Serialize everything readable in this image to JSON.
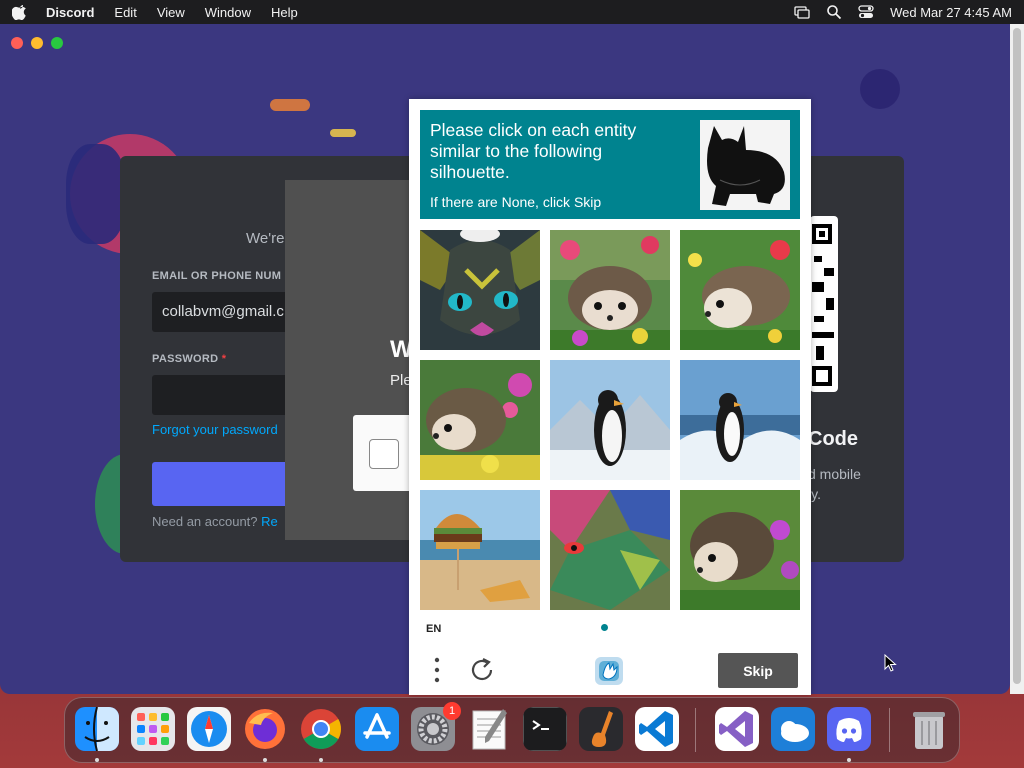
{
  "menubar": {
    "app_name": "Discord",
    "items": [
      "Edit",
      "View",
      "Window",
      "Help"
    ],
    "clock": "Wed Mar 27  4:45 AM",
    "icons": [
      "apple-icon",
      "screen-mirroring-icon",
      "spotlight-search-icon",
      "control-center-icon"
    ]
  },
  "login": {
    "subtitle": "We're",
    "email_label": "EMAIL OR PHONE NUM",
    "email_value": "collabvm@gmail.c",
    "password_label": "PASSWORD",
    "required_mark": "*",
    "forgot_link": "Forgot your password",
    "register_prefix": "Need an account?",
    "register_link": "Re",
    "qr_heading": "Code",
    "qr_sub": "d mobile\nly."
  },
  "overlay": {
    "heading_fragment": "W",
    "sub_fragment": "Ple"
  },
  "captcha": {
    "prompt_title": "Please click on each entity similar to the following silhouette.",
    "prompt_sub": "If there are None, click Skip",
    "tiles": [
      {
        "subject": "cat face"
      },
      {
        "subject": "hedgehog"
      },
      {
        "subject": "hedgehog"
      },
      {
        "subject": "hedgehog"
      },
      {
        "subject": "penguin"
      },
      {
        "subject": "penguin"
      },
      {
        "subject": "burger"
      },
      {
        "subject": "abstract"
      },
      {
        "subject": "hedgehog"
      }
    ],
    "language": "EN",
    "skip_label": "Skip",
    "accent_color": "#00838f"
  },
  "dock": {
    "apps": [
      "Finder",
      "Launchpad",
      "Safari",
      "Firefox",
      "Chrome",
      "App Store",
      "System Settings",
      "TextEdit",
      "Terminal",
      "GarageBand",
      "Visual Studio Code",
      "Visual Studio",
      "Weather",
      "Discord",
      "Trash"
    ],
    "settings_badge": "1"
  }
}
